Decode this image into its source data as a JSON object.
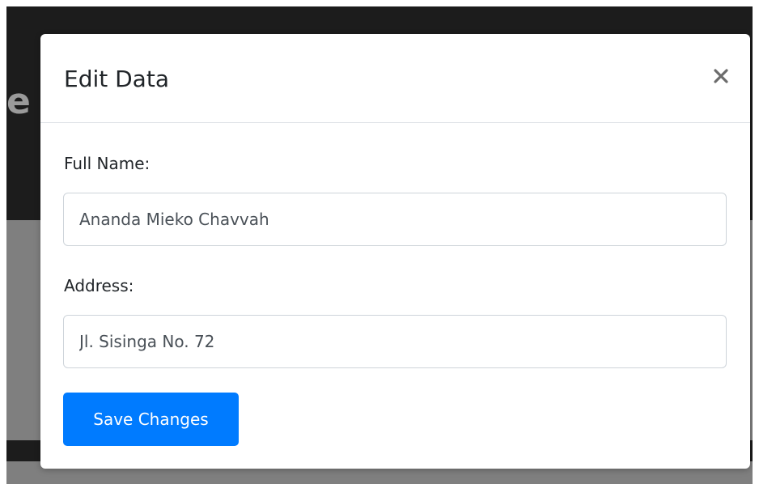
{
  "background": {
    "heading_fragment": "e"
  },
  "modal": {
    "title": "Edit Data",
    "close_icon": "close-icon",
    "fields": [
      {
        "label": "Full Name:",
        "value": "Ananda Mieko Chavvah"
      },
      {
        "label": "Address:",
        "value": "Jl. Sisinga No. 72"
      }
    ],
    "save_label": "Save Changes"
  },
  "colors": {
    "primary": "#007bff",
    "overlay": "#7f7f7f",
    "header_dark": "#1c1c1c",
    "text": "#212529"
  }
}
